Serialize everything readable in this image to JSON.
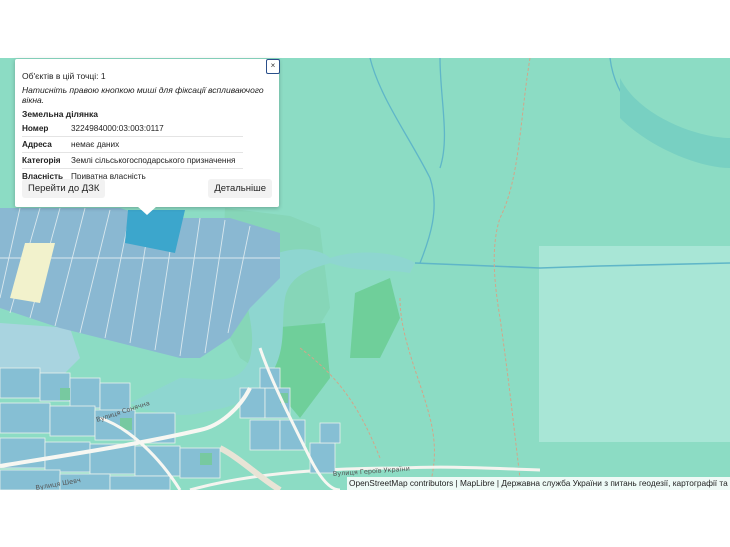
{
  "popup": {
    "close_label": "×",
    "count_text": "Об'єктів в цій точці: 1",
    "hint_text": "Натисніть правою кнопкою миші для фіксації вспливаючого вікна.",
    "section_title": "Земельна ділянка",
    "attributes": [
      {
        "label": "Номер",
        "value": "3224984000:03:003:0117"
      },
      {
        "label": "Адреса",
        "value": "немає даних"
      },
      {
        "label": "Категорія",
        "value": "Землі сільськогосподарського призначення"
      },
      {
        "label": "Власність",
        "value": "Приватна власність"
      }
    ],
    "goto_button": "Перейти до ДЗК",
    "details_button": "Детальніше"
  },
  "map": {
    "street_labels": [
      "Вулиця Сонячна",
      "Вулиця Шевч",
      "Вулиця Героїв України"
    ],
    "colors": {
      "background": "#8cdcc4",
      "parcel": "#8ab8d2",
      "selected_parcel": "#3ca6cc",
      "water": "#8ed6d0",
      "forest": "#6fcf9a",
      "overlay": "#a8e6d6"
    }
  },
  "attribution": "OpenStreetMap contributors | MapLibre | Державна служба України з питань геодезії, картографії та"
}
